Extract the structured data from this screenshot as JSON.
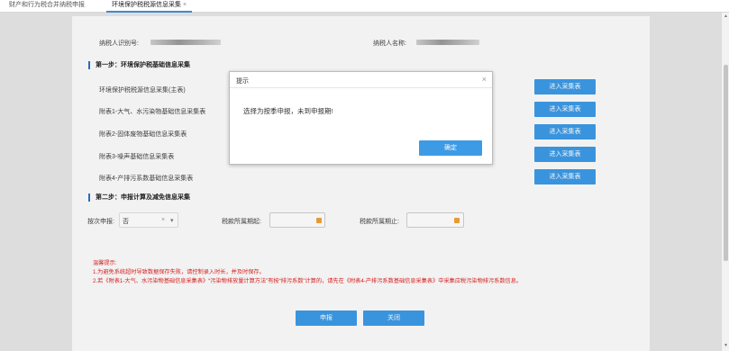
{
  "tabs": [
    {
      "label": "财产和行为税合并纳税申报"
    },
    {
      "label": "环境保护税税源信息采集",
      "close": "×"
    }
  ],
  "form": {
    "taxpayer_id_label": "纳税人识别号:",
    "taxpayer_name_label": "纳税人名称:",
    "step1_title": "第一步：环境保护税基础信息采集",
    "rows": [
      {
        "label": "环境保护税税源信息采集(主表)",
        "button": "进入采集表"
      },
      {
        "label": "附表1-大气、水污染物基础信息采集表",
        "button": "进入采集表"
      },
      {
        "label": "附表2-固体废物基础信息采集表",
        "button": "进入采集表"
      },
      {
        "label": "附表3-噪声基础信息采集表",
        "button": "进入采集表"
      },
      {
        "label": "附表4-产排污系数基础信息采集表",
        "button": "进入采集表"
      }
    ],
    "step2_title": "第二步：申报计算及减免信息采集",
    "by_period_label": "按次申报:",
    "by_period_value": "否",
    "by_period_clear": "×",
    "by_period_caret": "▾",
    "period_start_label": "税款所属期起:",
    "period_end_label": "税款所属期止:",
    "tips_title": "温馨提示:",
    "tips": [
      "1.为避免系统超时导致数据保存失败，请控制录入时长，并及时保存。",
      "2.若《附表1-大气、水污染物基础信息采集表》“污染物排放量计算方法”有按“排污系数”计算的，请先在《附表4-产排污系数基础信息采集表》中采集应税污染物排污系数信息。"
    ],
    "declare_button": "申报",
    "close_button": "关闭"
  },
  "dialog": {
    "title": "提示",
    "close": "×",
    "message": "选择为按季申报，未到申报期!",
    "ok_button": "确定"
  },
  "scrollbar": {
    "up": "▲",
    "down": "▼"
  },
  "colors": {
    "accent": "#3d9be6",
    "section_bar": "#2a73c8",
    "warning": "#e02020",
    "calendar": "#f0a23a"
  }
}
